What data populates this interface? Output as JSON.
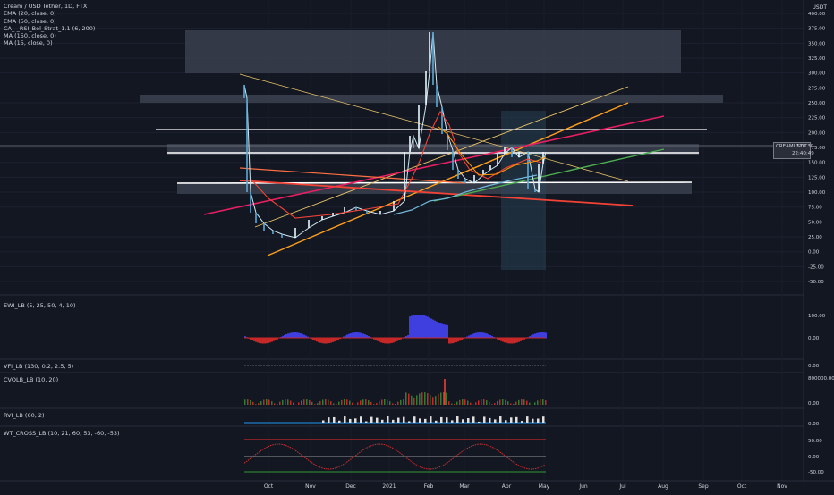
{
  "header": {
    "symbol_title": "Cream / USD Tether, 1D, FTX",
    "currency": "USDT"
  },
  "indicators": [
    "EMA (20, close, 0)",
    "EMA (50, close, 0)",
    "CA_-_RSI_Bol_Strat_1.1 (6, 200)",
    "MA (150, close, 0)",
    "MA (15, close, 0)"
  ],
  "price_tag": {
    "symbol": "CREAMUSDT",
    "price": "176.30",
    "countdown": "22:40:49"
  },
  "price_axis": [
    "400.00",
    "375.00",
    "350.00",
    "325.00",
    "300.00",
    "275.00",
    "250.00",
    "225.00",
    "200.00",
    "175.00",
    "150.00",
    "125.00",
    "100.00",
    "75.00",
    "50.00",
    "25.00",
    "0.00",
    "-25.00",
    "-50.00"
  ],
  "time_axis": [
    "Oct",
    "Nov",
    "Dec",
    "2021",
    "Feb",
    "Mar",
    "Apr",
    "May",
    "Jun",
    "Jul",
    "Aug",
    "Sep",
    "Oct",
    "Nov"
  ],
  "panes": [
    {
      "label": "EWI_LB (5, 25, 50, 4, 10)",
      "ticks": [
        "100.00",
        "0.00"
      ]
    },
    {
      "label": "VFI_LB (130, 0.2, 2.5, 5)",
      "ticks": [
        "0.00"
      ]
    },
    {
      "label": "CVOLB_LB (10, 20)",
      "ticks": [
        "800000.00",
        "0.00"
      ]
    },
    {
      "label": "RVI_LB (60, 2)",
      "ticks": [
        "0.00"
      ]
    },
    {
      "label": "WT_CROSS_LB (10, 21, 60, 53, -60, -53)",
      "ticks": [
        "50.00",
        "0.00",
        "-50.00"
      ]
    }
  ],
  "colors": {
    "background": "#131722",
    "up": "#26a69a",
    "down": "#ef5350",
    "zone": "#3a3f4d"
  }
}
